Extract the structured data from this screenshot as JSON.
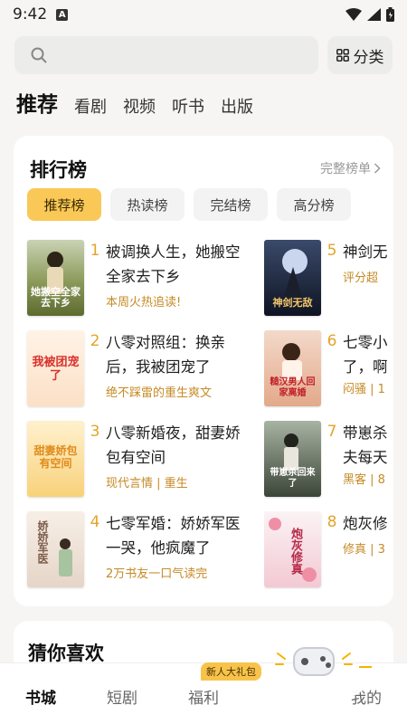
{
  "status": {
    "time": "9:42",
    "notif": "A"
  },
  "search": {
    "placeholder": "",
    "category_label": "分类"
  },
  "tabs": [
    "推荐",
    "看剧",
    "视频",
    "听书",
    "出版"
  ],
  "ranking": {
    "title": "排行榜",
    "more": "完整榜单",
    "chips": [
      "推荐榜",
      "热读榜",
      "完结榜",
      "高分榜"
    ],
    "books": [
      {
        "rank": "1",
        "name": "被调换人生，她搬空全家去下乡",
        "tag": "本周火热追读!",
        "cover_text": "她搬空全家去下乡"
      },
      {
        "rank": "2",
        "name": "八零对照组：换亲后，我被团宠了",
        "tag": "绝不踩雷的重生爽文",
        "cover_text": "我被团宠了"
      },
      {
        "rank": "3",
        "name": "八零新婚夜，甜妻娇包有空间",
        "tag": "现代言情 | 重生",
        "cover_text": "甜妻娇包有空间"
      },
      {
        "rank": "4",
        "name": "七零军婚：娇娇军医一哭，他疯魔了",
        "tag": "2万书友一口气读完",
        "cover_text": "娇娇军医"
      },
      {
        "rank": "5",
        "name": "神剑无",
        "tag": "评分超",
        "cover_text": "神剑无敌"
      },
      {
        "rank": "6",
        "name": "七零小",
        "name2": "了，啊",
        "tag": "闷骚 | 1",
        "cover_text": "糙汉男人回家离婚"
      },
      {
        "rank": "7",
        "name": "带崽杀",
        "name2": "夫每天",
        "tag": "黑客 | 8",
        "cover_text": "带崽杀回来了"
      },
      {
        "rank": "8",
        "name": "炮灰修",
        "tag": "修真 | 3",
        "cover_text": "炮灰修真"
      }
    ]
  },
  "guess": {
    "title": "猜你喜欢"
  },
  "nav": {
    "items": [
      "书城",
      "短剧",
      "福利",
      "我的"
    ],
    "badge": "新人大礼包"
  }
}
